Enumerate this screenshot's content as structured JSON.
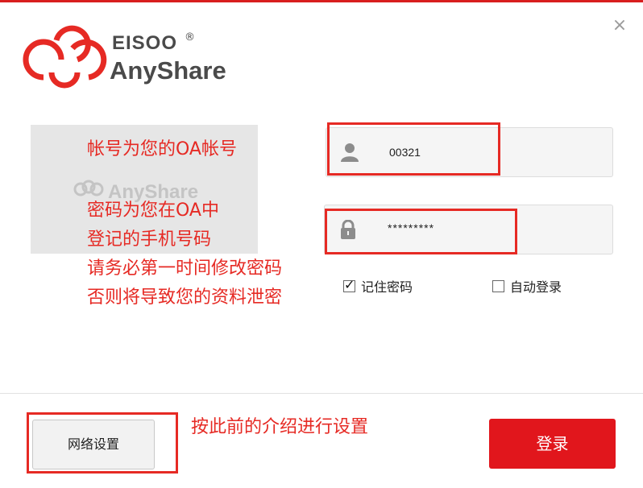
{
  "window": {
    "close_glyph": "×",
    "accent_color": "#d81e1e"
  },
  "logo": {
    "brand_top": "EISOO",
    "registered": "®",
    "brand_bottom": "AnyShare"
  },
  "ad_banner": {
    "watermark": "AnyShare"
  },
  "annotations": {
    "account_note": "帐号为您的OA帐号",
    "password_note_lines": [
      "密码为您在OA中",
      "登记的手机号码",
      "请务必第一时间修改密码",
      "否则将导致您的资料泄密"
    ],
    "network_note": "按此前的介绍进行设置"
  },
  "form": {
    "username": {
      "value": "00321",
      "icon": "user-icon"
    },
    "password": {
      "value": "*********",
      "icon": "lock-icon"
    },
    "remember_password": {
      "label": "记住密码",
      "checked": true
    },
    "auto_login": {
      "label": "自动登录",
      "checked": false
    }
  },
  "footer": {
    "network_settings_label": "网络设置",
    "login_label": "登录"
  }
}
